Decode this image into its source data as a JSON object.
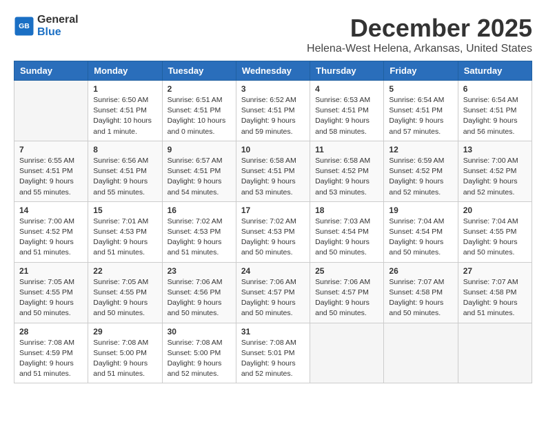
{
  "logo": {
    "line1": "General",
    "line2": "Blue"
  },
  "title": "December 2025",
  "location": "Helena-West Helena, Arkansas, United States",
  "weekdays": [
    "Sunday",
    "Monday",
    "Tuesday",
    "Wednesday",
    "Thursday",
    "Friday",
    "Saturday"
  ],
  "weeks": [
    [
      {
        "day": "",
        "info": ""
      },
      {
        "day": "1",
        "info": "Sunrise: 6:50 AM\nSunset: 4:51 PM\nDaylight: 10 hours\nand 1 minute."
      },
      {
        "day": "2",
        "info": "Sunrise: 6:51 AM\nSunset: 4:51 PM\nDaylight: 10 hours\nand 0 minutes."
      },
      {
        "day": "3",
        "info": "Sunrise: 6:52 AM\nSunset: 4:51 PM\nDaylight: 9 hours\nand 59 minutes."
      },
      {
        "day": "4",
        "info": "Sunrise: 6:53 AM\nSunset: 4:51 PM\nDaylight: 9 hours\nand 58 minutes."
      },
      {
        "day": "5",
        "info": "Sunrise: 6:54 AM\nSunset: 4:51 PM\nDaylight: 9 hours\nand 57 minutes."
      },
      {
        "day": "6",
        "info": "Sunrise: 6:54 AM\nSunset: 4:51 PM\nDaylight: 9 hours\nand 56 minutes."
      }
    ],
    [
      {
        "day": "7",
        "info": "Sunrise: 6:55 AM\nSunset: 4:51 PM\nDaylight: 9 hours\nand 55 minutes."
      },
      {
        "day": "8",
        "info": "Sunrise: 6:56 AM\nSunset: 4:51 PM\nDaylight: 9 hours\nand 55 minutes."
      },
      {
        "day": "9",
        "info": "Sunrise: 6:57 AM\nSunset: 4:51 PM\nDaylight: 9 hours\nand 54 minutes."
      },
      {
        "day": "10",
        "info": "Sunrise: 6:58 AM\nSunset: 4:51 PM\nDaylight: 9 hours\nand 53 minutes."
      },
      {
        "day": "11",
        "info": "Sunrise: 6:58 AM\nSunset: 4:52 PM\nDaylight: 9 hours\nand 53 minutes."
      },
      {
        "day": "12",
        "info": "Sunrise: 6:59 AM\nSunset: 4:52 PM\nDaylight: 9 hours\nand 52 minutes."
      },
      {
        "day": "13",
        "info": "Sunrise: 7:00 AM\nSunset: 4:52 PM\nDaylight: 9 hours\nand 52 minutes."
      }
    ],
    [
      {
        "day": "14",
        "info": "Sunrise: 7:00 AM\nSunset: 4:52 PM\nDaylight: 9 hours\nand 51 minutes."
      },
      {
        "day": "15",
        "info": "Sunrise: 7:01 AM\nSunset: 4:53 PM\nDaylight: 9 hours\nand 51 minutes."
      },
      {
        "day": "16",
        "info": "Sunrise: 7:02 AM\nSunset: 4:53 PM\nDaylight: 9 hours\nand 51 minutes."
      },
      {
        "day": "17",
        "info": "Sunrise: 7:02 AM\nSunset: 4:53 PM\nDaylight: 9 hours\nand 50 minutes."
      },
      {
        "day": "18",
        "info": "Sunrise: 7:03 AM\nSunset: 4:54 PM\nDaylight: 9 hours\nand 50 minutes."
      },
      {
        "day": "19",
        "info": "Sunrise: 7:04 AM\nSunset: 4:54 PM\nDaylight: 9 hours\nand 50 minutes."
      },
      {
        "day": "20",
        "info": "Sunrise: 7:04 AM\nSunset: 4:55 PM\nDaylight: 9 hours\nand 50 minutes."
      }
    ],
    [
      {
        "day": "21",
        "info": "Sunrise: 7:05 AM\nSunset: 4:55 PM\nDaylight: 9 hours\nand 50 minutes."
      },
      {
        "day": "22",
        "info": "Sunrise: 7:05 AM\nSunset: 4:55 PM\nDaylight: 9 hours\nand 50 minutes."
      },
      {
        "day": "23",
        "info": "Sunrise: 7:06 AM\nSunset: 4:56 PM\nDaylight: 9 hours\nand 50 minutes."
      },
      {
        "day": "24",
        "info": "Sunrise: 7:06 AM\nSunset: 4:57 PM\nDaylight: 9 hours\nand 50 minutes."
      },
      {
        "day": "25",
        "info": "Sunrise: 7:06 AM\nSunset: 4:57 PM\nDaylight: 9 hours\nand 50 minutes."
      },
      {
        "day": "26",
        "info": "Sunrise: 7:07 AM\nSunset: 4:58 PM\nDaylight: 9 hours\nand 50 minutes."
      },
      {
        "day": "27",
        "info": "Sunrise: 7:07 AM\nSunset: 4:58 PM\nDaylight: 9 hours\nand 51 minutes."
      }
    ],
    [
      {
        "day": "28",
        "info": "Sunrise: 7:08 AM\nSunset: 4:59 PM\nDaylight: 9 hours\nand 51 minutes."
      },
      {
        "day": "29",
        "info": "Sunrise: 7:08 AM\nSunset: 5:00 PM\nDaylight: 9 hours\nand 51 minutes."
      },
      {
        "day": "30",
        "info": "Sunrise: 7:08 AM\nSunset: 5:00 PM\nDaylight: 9 hours\nand 52 minutes."
      },
      {
        "day": "31",
        "info": "Sunrise: 7:08 AM\nSunset: 5:01 PM\nDaylight: 9 hours\nand 52 minutes."
      },
      {
        "day": "",
        "info": ""
      },
      {
        "day": "",
        "info": ""
      },
      {
        "day": "",
        "info": ""
      }
    ]
  ]
}
